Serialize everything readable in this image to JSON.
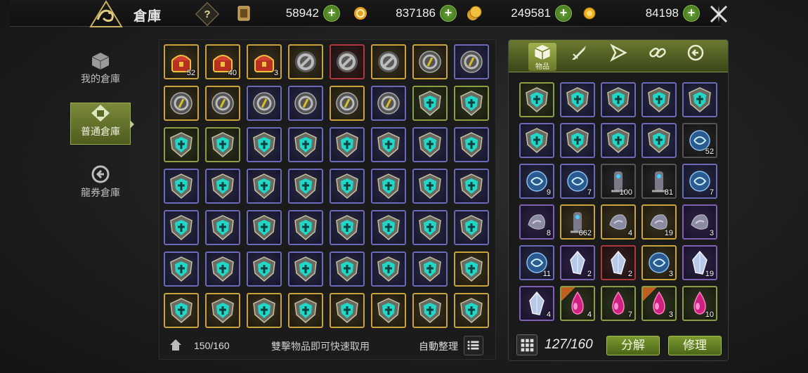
{
  "header": {
    "title": "倉庫",
    "help_label": "?"
  },
  "currencies": [
    {
      "icon": "card-icon",
      "value": "58942"
    },
    {
      "icon": "ring-coin-icon",
      "value": "837186"
    },
    {
      "icon": "gold-coins-icon",
      "value": "249581"
    },
    {
      "icon": "gold-coin-icon",
      "value": "84198"
    }
  ],
  "nav": [
    {
      "label": "我的倉庫",
      "icon": "box-icon"
    },
    {
      "label": "普通倉庫",
      "icon": "warehouse-icon"
    },
    {
      "label": "龍券倉庫",
      "icon": "dragon-coupon-icon"
    }
  ],
  "storage": {
    "slots": [
      {
        "f": "gold",
        "i": "chest",
        "n": "52"
      },
      {
        "f": "gold",
        "i": "chest",
        "n": "40"
      },
      {
        "f": "gold",
        "i": "chest",
        "n": "3"
      },
      {
        "f": "gold",
        "i": "ban",
        "n": ""
      },
      {
        "f": "red",
        "i": "ban",
        "n": ""
      },
      {
        "f": "gold",
        "i": "ban",
        "n": ""
      },
      {
        "f": "gold",
        "i": "gem",
        "n": ""
      },
      {
        "f": "blue",
        "i": "gem",
        "n": ""
      },
      {
        "f": "gold",
        "i": "gem",
        "n": ""
      },
      {
        "f": "gold",
        "i": "gem",
        "n": ""
      },
      {
        "f": "blue",
        "i": "gem",
        "n": ""
      },
      {
        "f": "blue",
        "i": "gem",
        "n": ""
      },
      {
        "f": "gold",
        "i": "gem",
        "n": ""
      },
      {
        "f": "blue",
        "i": "gem",
        "n": ""
      },
      {
        "f": "green",
        "i": "shield",
        "n": ""
      },
      {
        "f": "green",
        "i": "shield",
        "n": ""
      },
      {
        "f": "green",
        "i": "shield",
        "n": ""
      },
      {
        "f": "green",
        "i": "shield",
        "n": ""
      },
      {
        "f": "blue",
        "i": "shield",
        "n": ""
      },
      {
        "f": "blue",
        "i": "shield",
        "n": ""
      },
      {
        "f": "blue",
        "i": "shield",
        "n": ""
      },
      {
        "f": "blue",
        "i": "shield",
        "n": ""
      },
      {
        "f": "blue",
        "i": "shield",
        "n": ""
      },
      {
        "f": "blue",
        "i": "shield",
        "n": ""
      },
      {
        "f": "blue",
        "i": "shield",
        "n": ""
      },
      {
        "f": "blue",
        "i": "shield",
        "n": ""
      },
      {
        "f": "blue",
        "i": "shield",
        "n": ""
      },
      {
        "f": "blue",
        "i": "shield",
        "n": ""
      },
      {
        "f": "blue",
        "i": "shield",
        "n": ""
      },
      {
        "f": "blue",
        "i": "shield",
        "n": ""
      },
      {
        "f": "blue",
        "i": "shield",
        "n": ""
      },
      {
        "f": "blue",
        "i": "shield",
        "n": ""
      },
      {
        "f": "blue",
        "i": "shield",
        "n": ""
      },
      {
        "f": "blue",
        "i": "shield",
        "n": ""
      },
      {
        "f": "blue",
        "i": "shield",
        "n": ""
      },
      {
        "f": "blue",
        "i": "shield",
        "n": ""
      },
      {
        "f": "blue",
        "i": "shield",
        "n": ""
      },
      {
        "f": "blue",
        "i": "shield",
        "n": ""
      },
      {
        "f": "blue",
        "i": "shield",
        "n": ""
      },
      {
        "f": "blue",
        "i": "shield",
        "n": ""
      },
      {
        "f": "blue",
        "i": "shield",
        "n": ""
      },
      {
        "f": "blue",
        "i": "shield",
        "n": ""
      },
      {
        "f": "blue",
        "i": "shield",
        "n": ""
      },
      {
        "f": "blue",
        "i": "shield",
        "n": ""
      },
      {
        "f": "blue",
        "i": "shield",
        "n": ""
      },
      {
        "f": "blue",
        "i": "shield",
        "n": ""
      },
      {
        "f": "blue",
        "i": "shield",
        "n": ""
      },
      {
        "f": "gold",
        "i": "shield",
        "n": ""
      },
      {
        "f": "gold",
        "i": "shield",
        "n": ""
      },
      {
        "f": "gold",
        "i": "shield",
        "n": ""
      },
      {
        "f": "gold",
        "i": "shield",
        "n": ""
      },
      {
        "f": "gold",
        "i": "shield",
        "n": ""
      },
      {
        "f": "gold",
        "i": "shield",
        "n": ""
      },
      {
        "f": "gold",
        "i": "shield",
        "n": ""
      },
      {
        "f": "gold",
        "i": "shield",
        "n": ""
      },
      {
        "f": "gold",
        "i": "shield",
        "n": ""
      }
    ],
    "capacity": "150/160",
    "hint": "雙擊物品即可快速取用",
    "sort_label": "自動整理"
  },
  "inventory": {
    "tabs": [
      {
        "label": "物品",
        "icon": "cube-icon"
      },
      {
        "label": "",
        "icon": "sword-icon"
      },
      {
        "label": "",
        "icon": "flag-icon"
      },
      {
        "label": "",
        "icon": "chain-icon"
      },
      {
        "label": "",
        "icon": "dragon-coin-icon"
      }
    ],
    "slots": [
      {
        "f": "green",
        "i": "shield",
        "n": ""
      },
      {
        "f": "blue",
        "i": "shield",
        "n": ""
      },
      {
        "f": "blue",
        "i": "shield",
        "n": ""
      },
      {
        "f": "blue",
        "i": "shield",
        "n": ""
      },
      {
        "f": "blue",
        "i": "shield",
        "n": ""
      },
      {
        "f": "blue",
        "i": "shield",
        "n": ""
      },
      {
        "f": "blue",
        "i": "shield",
        "n": ""
      },
      {
        "f": "blue",
        "i": "shield",
        "n": ""
      },
      {
        "f": "blue",
        "i": "shield",
        "n": ""
      },
      {
        "f": "dark",
        "i": "orb",
        "n": "52"
      },
      {
        "f": "blue",
        "i": "orb",
        "n": "9"
      },
      {
        "f": "blue",
        "i": "orb",
        "n": "7"
      },
      {
        "f": "dark",
        "i": "totem",
        "n": "100"
      },
      {
        "f": "dark",
        "i": "totem",
        "n": "81"
      },
      {
        "f": "blue",
        "i": "orb",
        "n": "7"
      },
      {
        "f": "purple",
        "i": "stone",
        "n": "8"
      },
      {
        "f": "gold",
        "i": "totem",
        "n": "662"
      },
      {
        "f": "gold",
        "i": "stone",
        "n": "4"
      },
      {
        "f": "gold",
        "i": "stone",
        "n": "19"
      },
      {
        "f": "purple",
        "i": "stone",
        "n": "3"
      },
      {
        "f": "blue",
        "i": "orb",
        "n": "11"
      },
      {
        "f": "purple",
        "i": "crystal",
        "n": "2"
      },
      {
        "f": "red",
        "i": "crystal",
        "n": "2"
      },
      {
        "f": "gold",
        "i": "orb",
        "n": "3"
      },
      {
        "f": "purple",
        "i": "crystal",
        "n": "19"
      },
      {
        "f": "purple",
        "i": "crystal",
        "n": "4"
      },
      {
        "f": "green",
        "i": "drop",
        "n": "4",
        "r": true
      },
      {
        "f": "green",
        "i": "drop",
        "n": "7"
      },
      {
        "f": "green",
        "i": "drop",
        "n": "3",
        "r": true
      },
      {
        "f": "green",
        "i": "drop",
        "n": "10"
      }
    ],
    "capacity": "127/160",
    "decompose_label": "分解",
    "repair_label": "修理"
  }
}
